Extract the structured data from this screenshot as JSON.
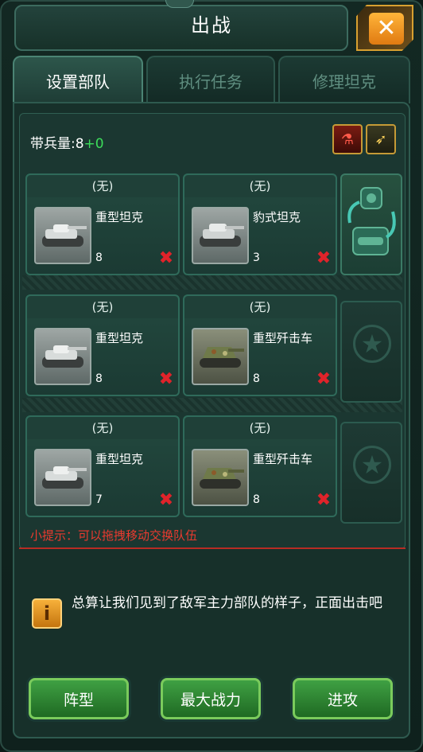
{
  "window": {
    "title": "出战",
    "close_icon": "close-icon"
  },
  "tabs": [
    {
      "label": "设置部队",
      "active": true
    },
    {
      "label": "执行任务",
      "active": false
    },
    {
      "label": "修理坦克",
      "active": false
    }
  ],
  "capacity": {
    "label": "带兵量:8",
    "bonus": "+0"
  },
  "rows": [
    [
      {
        "slot": "(无)",
        "name": "重型坦克",
        "count": "8",
        "camo": "gray"
      },
      {
        "slot": "(无)",
        "name": "豹式坦克",
        "count": "3",
        "camo": "gray"
      }
    ],
    [
      {
        "slot": "(无)",
        "name": "重型坦克",
        "count": "8",
        "camo": "gray"
      },
      {
        "slot": "(无)",
        "name": "重型歼击车",
        "count": "8",
        "camo": "green"
      }
    ],
    [
      {
        "slot": "(无)",
        "name": "重型坦克",
        "count": "7",
        "camo": "gray"
      },
      {
        "slot": "(无)",
        "name": "重型歼击车",
        "count": "8",
        "camo": "green"
      }
    ]
  ],
  "hint": "小提示：可以拖拽移动交换队伍",
  "info": {
    "icon": "i",
    "text": "总算让我们见到了敌军主力部队的样子，正面出击吧"
  },
  "actions": [
    {
      "label": "阵型"
    },
    {
      "label": "最大战力"
    },
    {
      "label": "进攻"
    }
  ],
  "colors": {
    "accent_green": "#3cdc5a",
    "hint_red": "#ea3a2f",
    "button_green": "#3fa043"
  }
}
